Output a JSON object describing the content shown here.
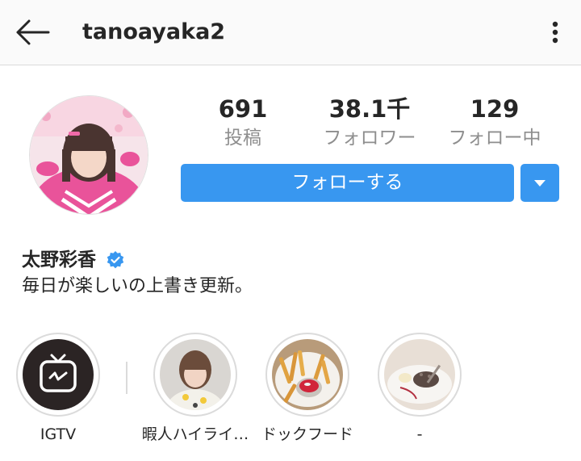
{
  "header": {
    "username": "tanoayaka2"
  },
  "profile": {
    "stats": [
      {
        "value": "691",
        "label": "投稿"
      },
      {
        "value": "38.1千",
        "label": "フォロワー"
      },
      {
        "value": "129",
        "label": "フォロー中"
      }
    ],
    "follow_label": "フォローする",
    "name": "太野彩香",
    "bio": "毎日が楽しいの上書き更新。"
  },
  "highlights": [
    {
      "label": "IGTV"
    },
    {
      "label": "暇人ハイライ…"
    },
    {
      "label": "ドックフード"
    },
    {
      "label": "-"
    }
  ],
  "colors": {
    "accent": "#3897f0",
    "secondary_text": "#8e8e8e",
    "header_bg": "#fafafa"
  }
}
